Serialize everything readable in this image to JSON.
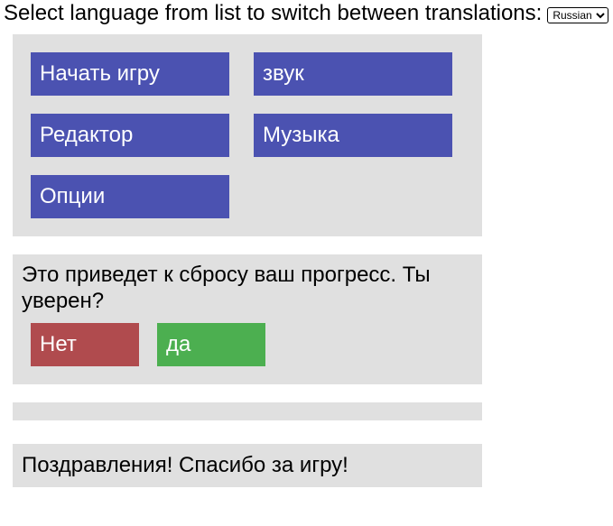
{
  "header": {
    "instruction": "Select language from list to switch between translations:",
    "language_selected": "Russian"
  },
  "menu": {
    "start_game": "Начать игру",
    "sound": "звук",
    "editor": "Редактор",
    "music": "Музыка",
    "options": "Опции"
  },
  "confirm": {
    "message": "Это приведет к сбросу ваш прогресс. Ты уверен?",
    "no_label": "Нет",
    "yes_label": "да"
  },
  "congrats": {
    "message": "Поздравления! Спасибо за игру!"
  },
  "colors": {
    "menu_button": "#4b52b1",
    "no_button": "#b04b4e",
    "yes_button": "#4caf50",
    "panel_bg": "#e0e0e0"
  }
}
